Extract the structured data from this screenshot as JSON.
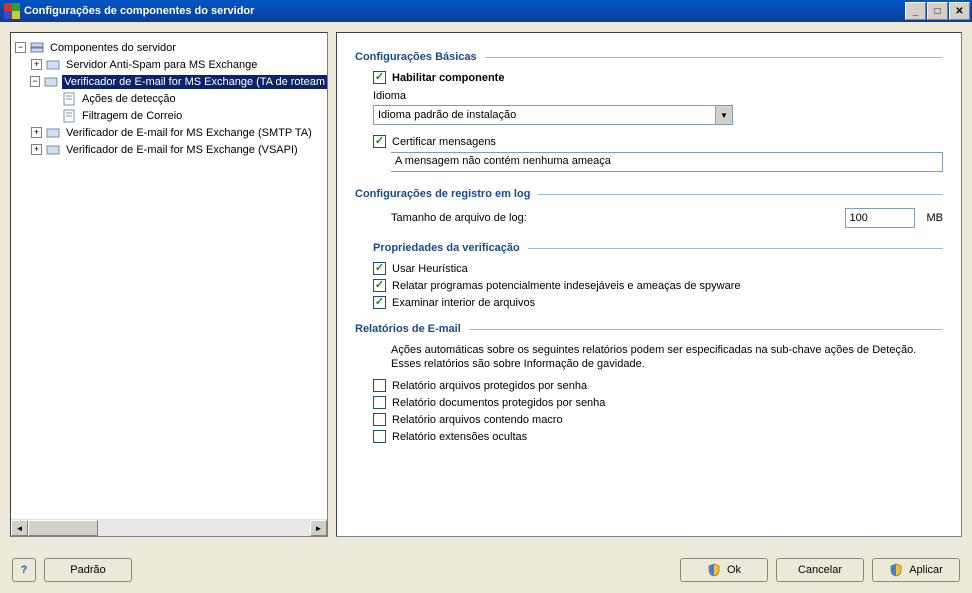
{
  "window": {
    "title": "Configurações de componentes do servidor"
  },
  "tree": {
    "root": "Componentes do servidor",
    "items": [
      {
        "label": "Servidor Anti-Spam para MS Exchange",
        "expander": "+"
      },
      {
        "label": "Verificador de E-mail for MS Exchange (TA de roteam",
        "expander": "−",
        "selected": true
      },
      {
        "label": "Ações de detecção",
        "child": true
      },
      {
        "label": "Filtragem de Correio",
        "child": true
      },
      {
        "label": "Verificador de E-mail for MS Exchange (SMTP TA)",
        "expander": "+"
      },
      {
        "label": "Verificador de E-mail for MS Exchange (VSAPI)",
        "expander": "+"
      }
    ]
  },
  "sections": {
    "basic": {
      "title": "Configurações Básicas",
      "enable": "Habilitar componente",
      "language_label": "Idioma",
      "language_value": "Idioma padrão de instalação",
      "certify_label": "Certificar mensagens",
      "certify_text": "A mensagem não contém nenhuma ameaça"
    },
    "logging": {
      "title": "Configurações de registro em log",
      "size_label": "Tamanho de arquivo de log:",
      "size_value": "100",
      "size_unit": "MB"
    },
    "scan": {
      "title": "Propriedades da verificação",
      "heuristics": "Usar Heurística",
      "pup": "Relatar programas potencialmente indesejáveis e ameaças de spyware",
      "archives": "Examinar interior de arquivos"
    },
    "reports": {
      "title": "Relatórios de E-mail",
      "desc": "Ações automáticas sobre os seguintes relatórios podem ser especificadas na sub-chave ações de Deteção. Esses relatórios são sobre Informação de gavidade.",
      "r1": "Relatório arquivos protegidos por senha",
      "r2": "Relatório documentos protegidos por senha",
      "r3": "Relatório arquivos contendo macro",
      "r4": "Relatório extensões ocultas"
    }
  },
  "buttons": {
    "default": "Padrão",
    "ok": "Ok",
    "cancel": "Cancelar",
    "apply": "Aplicar"
  }
}
